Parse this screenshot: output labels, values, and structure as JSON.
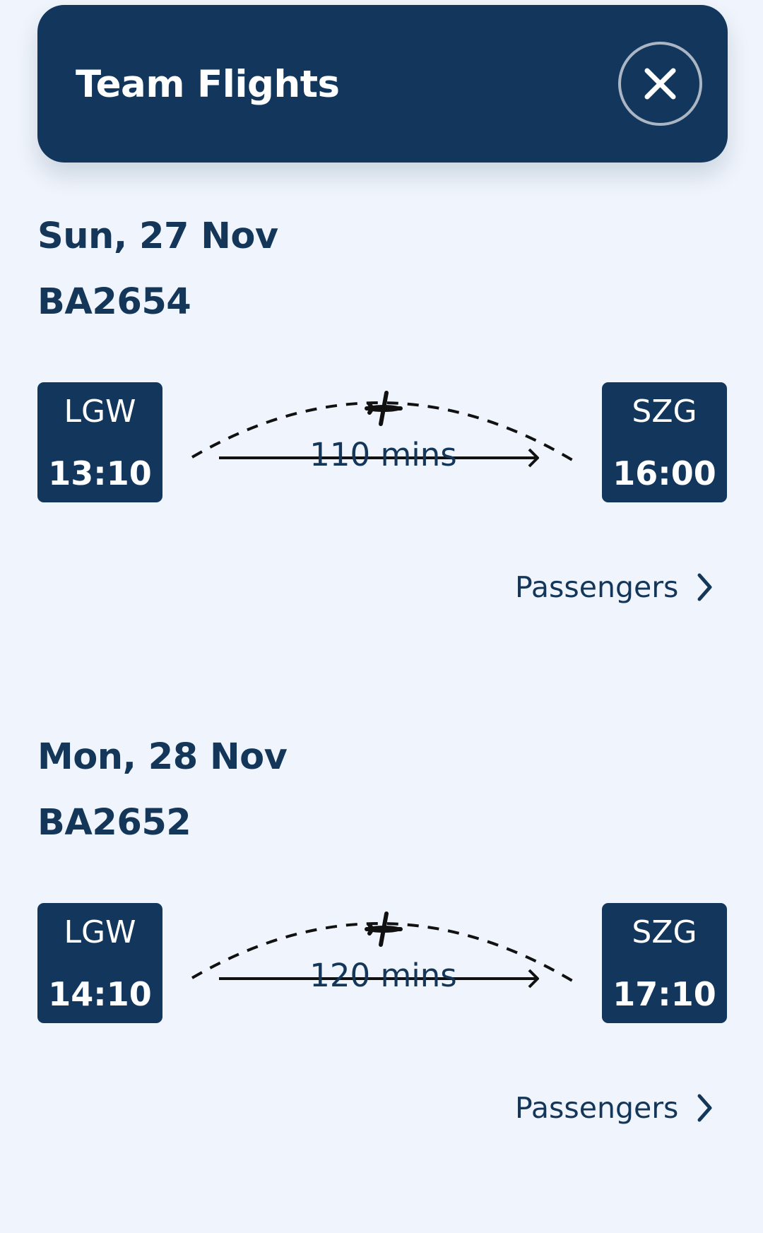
{
  "header": {
    "title": "Team Flights",
    "close_icon": "close-icon"
  },
  "flights": [
    {
      "date": "Sun, 27 Nov",
      "flight_number": "BA2654",
      "origin": {
        "code": "LGW",
        "time": "13:10"
      },
      "destination": {
        "code": "SZG",
        "time": "16:00"
      },
      "duration": "110 mins",
      "passengers_label": "Passengers"
    },
    {
      "date": "Mon, 28 Nov",
      "flight_number": "BA2652",
      "origin": {
        "code": "LGW",
        "time": "14:10"
      },
      "destination": {
        "code": "SZG",
        "time": "17:10"
      },
      "duration": "120 mins",
      "passengers_label": "Passengers"
    }
  ],
  "colors": {
    "navy": "#13375c",
    "background": "#f0f4fc",
    "text": "#143659"
  }
}
